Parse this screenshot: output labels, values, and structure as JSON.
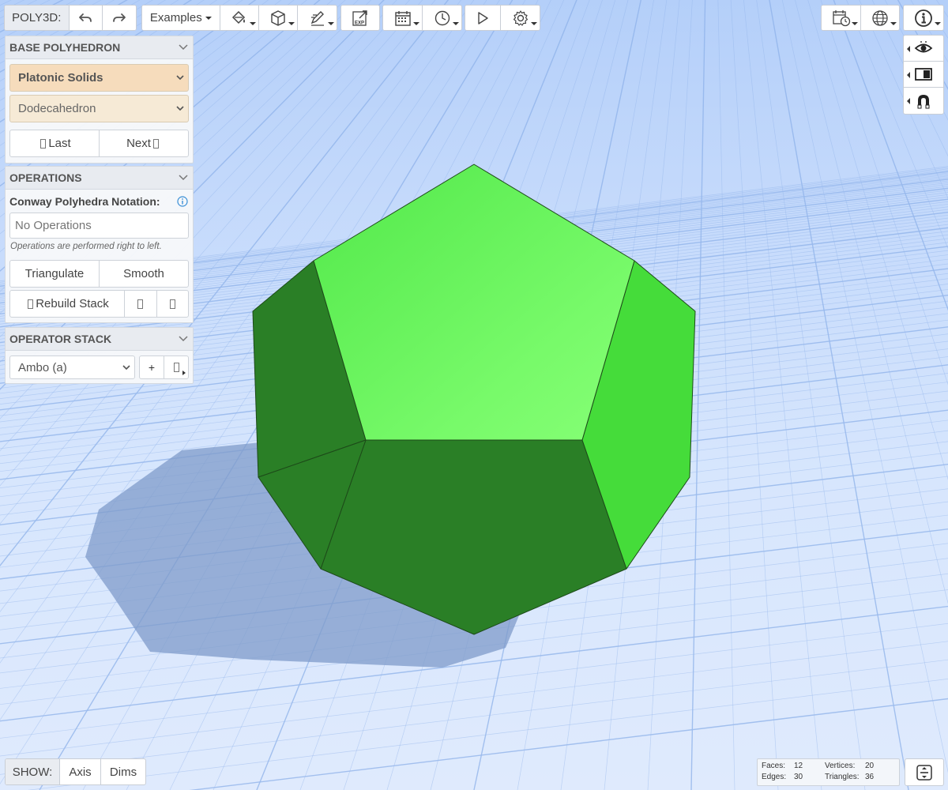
{
  "toolbar": {
    "app_label": "POLY3D:",
    "examples_label": "Examples",
    "icons": [
      "undo-icon",
      "redo-icon",
      "paint-bucket-icon",
      "cube-icon",
      "edit-pen-icon",
      "export-icon",
      "calendar-icon",
      "clock-icon",
      "play-icon",
      "gear-icon",
      "calendar-clock-icon",
      "globe-icon",
      "info-icon"
    ],
    "export_badge": "EXP"
  },
  "right_tools": [
    "eye-icon",
    "panel-toggle-icon",
    "magnet-icon"
  ],
  "base_polyhedron": {
    "title": "BASE POLYHEDRON",
    "family_select": "Platonic Solids",
    "solid_select": "Dodecahedron",
    "last_label": "Last",
    "next_label": "Next"
  },
  "operations": {
    "title": "OPERATIONS",
    "notation_label": "Conway Polyhedra Notation:",
    "notation_placeholder": "No Operations",
    "hint": "Operations are performed right to left.",
    "triangulate_label": "Triangulate",
    "smooth_label": "Smooth",
    "rebuild_label": "Rebuild Stack"
  },
  "operator_stack": {
    "title": "OPERATOR STACK",
    "operator_select": "Ambo (a)",
    "add_label": "+"
  },
  "show_bar": {
    "label": "SHOW:",
    "axis_label": "Axis",
    "dims_label": "Dims"
  },
  "stats": {
    "faces_label": "Faces:",
    "faces": "12",
    "vertices_label": "Vertices:",
    "vertices": "20",
    "edges_label": "Edges:",
    "edges": "30",
    "triangles_label": "Triangles:",
    "triangles": "36"
  },
  "colors": {
    "face_light": "#66f05c",
    "face_mid": "#45dc3a",
    "face_dark": "#2a7f26",
    "grid": "#8fb3ea",
    "shadow": "#7f9bc9"
  }
}
